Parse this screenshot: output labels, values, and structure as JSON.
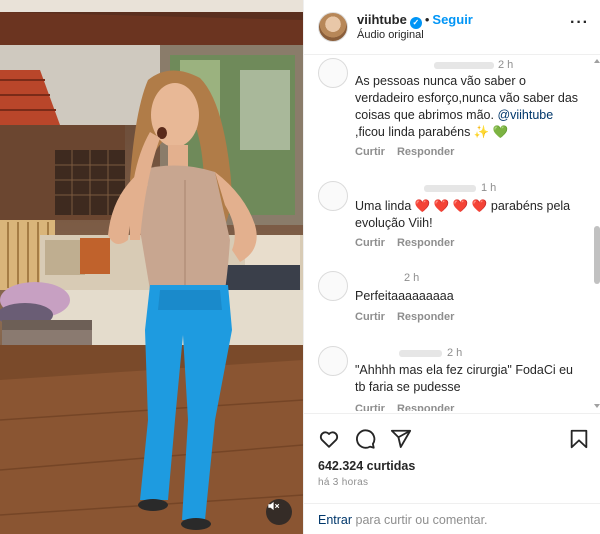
{
  "post": {
    "username": "viihtube",
    "follow_label": "Seguir",
    "subtitle": "Áudio original"
  },
  "comments": [
    {
      "time": "2 h",
      "text_before": "As pessoas nunca vão saber o verdadeiro esforço,nunca vão saber das coisas que abrimos mão. ",
      "mention": "@viihtube",
      "text_after": " ,ficou linda parabéns ✨ 💚",
      "reply_label": "Curtir",
      "answer_label": "Responder"
    },
    {
      "time": "1 h",
      "text": "Uma linda ❤️ ❤️ ❤️ ❤️ parabéns pela evolução Viih!",
      "reply_label": "Curtir",
      "answer_label": "Responder"
    },
    {
      "time": "2 h",
      "text": "Perfeitaaaaaaaaa",
      "reply_label": "Curtir",
      "answer_label": "Responder"
    },
    {
      "time": "2 h",
      "text": "\"Ahhhh mas ela fez cirurgia\" FodaCi eu tb faria se pudesse",
      "reply_label": "Curtir",
      "answer_label": "Responder"
    }
  ],
  "stats": {
    "likes": "642.324 curtidas",
    "time_ago": "há 3 horas"
  },
  "comment_box": {
    "link": "Entrar",
    "rest": " para curtir ou comentar."
  },
  "icons": [
    "heart-icon",
    "comment-icon",
    "share-icon",
    "bookmark-icon",
    "mute-icon",
    "more-icon",
    "verified-icon"
  ],
  "colors": {
    "accent": "#0095f6",
    "pants": "#1e9be0"
  }
}
